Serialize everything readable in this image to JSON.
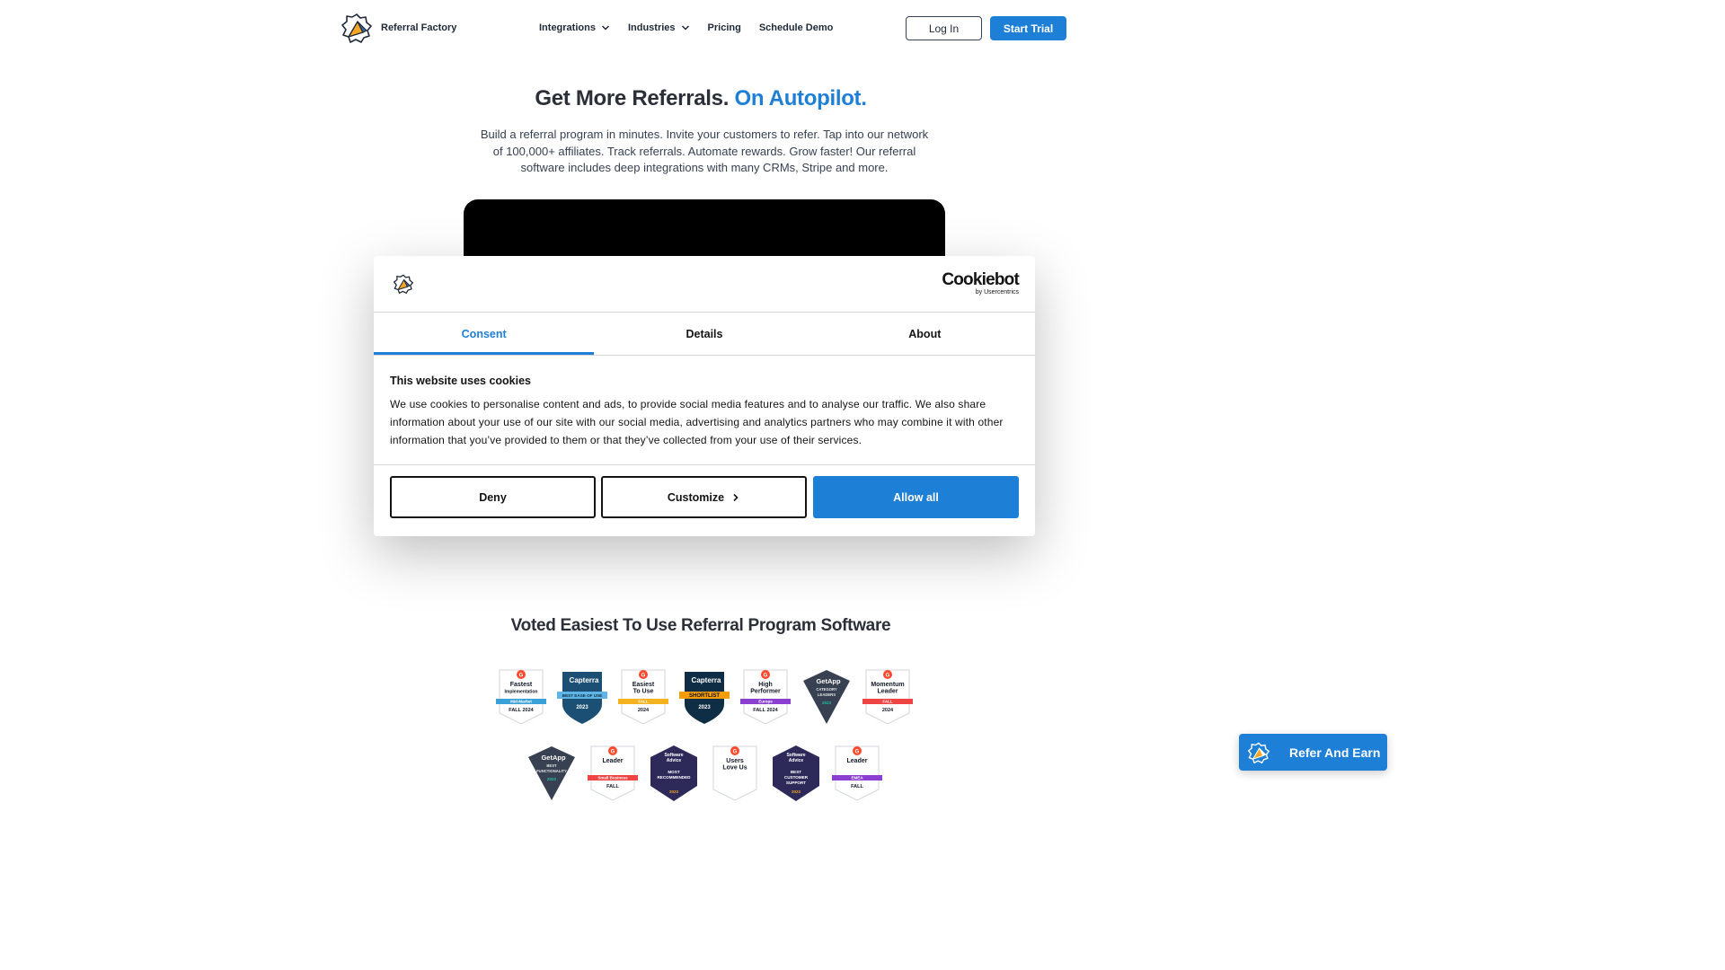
{
  "header": {
    "brand": "Referral Factory",
    "nav": [
      {
        "label": "Integrations",
        "has_dropdown": true
      },
      {
        "label": "Industries",
        "has_dropdown": true
      },
      {
        "label": "Pricing",
        "has_dropdown": false
      },
      {
        "label": "Schedule Demo",
        "has_dropdown": false
      }
    ],
    "login_label": "Log In",
    "trial_label": "Start Trial"
  },
  "hero": {
    "title_main": "Get More Referrals.",
    "title_accent": "On Autopilot.",
    "description": "Build a referral program in minutes. Invite your customers to refer. Tap into our network of 100,000+ affiliates. Track referrals. Automate rewards. Grow faster! Our referral software includes deep integrations with many CRMs, Stripe and more."
  },
  "cookie_dialog": {
    "provider": "Cookiebot",
    "provider_sub": "by Usercentrics",
    "tabs": [
      {
        "label": "Consent",
        "active": true
      },
      {
        "label": "Details",
        "active": false
      },
      {
        "label": "About",
        "active": false
      }
    ],
    "heading": "This website uses cookies",
    "body": "We use cookies to personalise content and ads, to provide social media features and to analyse our traffic. We also share information about your use of our site with our social media, advertising and analytics partners who may combine it with other information that you’ve provided to them or that they’ve collected from your use of their services.",
    "deny_label": "Deny",
    "customize_label": "Customize",
    "allow_label": "Allow all"
  },
  "awards": {
    "title": "Voted Easiest To Use Referral Program Software",
    "row1": [
      {
        "kind": "g2",
        "lines": [
          "Fastest",
          "Implementation"
        ],
        "ribbon": "Mid-Market",
        "ribbon_color": "#3aa0d8",
        "foot": "FALL 2024"
      },
      {
        "kind": "capterra",
        "top": "Capterra",
        "ribbon": "BEST EASE OF USE",
        "year": "2023"
      },
      {
        "kind": "g2",
        "lines": [
          "Easiest",
          "To Use"
        ],
        "ribbon": "FALL",
        "ribbon_color": "#f5b21f",
        "foot": "2024"
      },
      {
        "kind": "capterra-dark",
        "top": "Capterra",
        "ribbon": "SHORTLIST",
        "year": "2023"
      },
      {
        "kind": "g2",
        "lines": [
          "High",
          "Performer"
        ],
        "ribbon": "Europe",
        "ribbon_color": "#8a3fd1",
        "foot": "FALL 2024"
      },
      {
        "kind": "getapp",
        "top": "GetApp",
        "lines": [
          "CATEGORY",
          "LEADERS"
        ],
        "year": "2023"
      },
      {
        "kind": "g2",
        "lines": [
          "Momentum",
          "Leader"
        ],
        "ribbon": "FALL",
        "ribbon_color": "#ef4444",
        "foot": "2024"
      }
    ],
    "row2": [
      {
        "kind": "getapp",
        "top": "GetApp",
        "lines": [
          "BEST",
          "FUNCTIONALITY"
        ],
        "year": "2023"
      },
      {
        "kind": "g2",
        "lines": [
          "Leader"
        ],
        "ribbon": "Small Business",
        "ribbon_color": "#ef4444",
        "foot": "FALL"
      },
      {
        "kind": "sa",
        "top": "Software Advice",
        "lines": [
          "MOST",
          "RECOMMENDED"
        ],
        "year": "2023"
      },
      {
        "kind": "g2",
        "lines": [
          "Users",
          "Love Us"
        ],
        "ribbon": "",
        "ribbon_color": "#ffffff",
        "foot": ""
      },
      {
        "kind": "sa",
        "top": "Software Advice",
        "lines": [
          "BEST",
          "CUSTOMER",
          "SUPPORT"
        ],
        "year": "2023"
      },
      {
        "kind": "g2",
        "lines": [
          "Leader"
        ],
        "ribbon": "EMEA",
        "ribbon_color": "#8a3fd1",
        "foot": "FALL"
      }
    ]
  },
  "floating": {
    "refer_label": "Refer And Earn"
  },
  "colors": {
    "accent": "#1e7fd6",
    "text": "#2b2f38"
  }
}
